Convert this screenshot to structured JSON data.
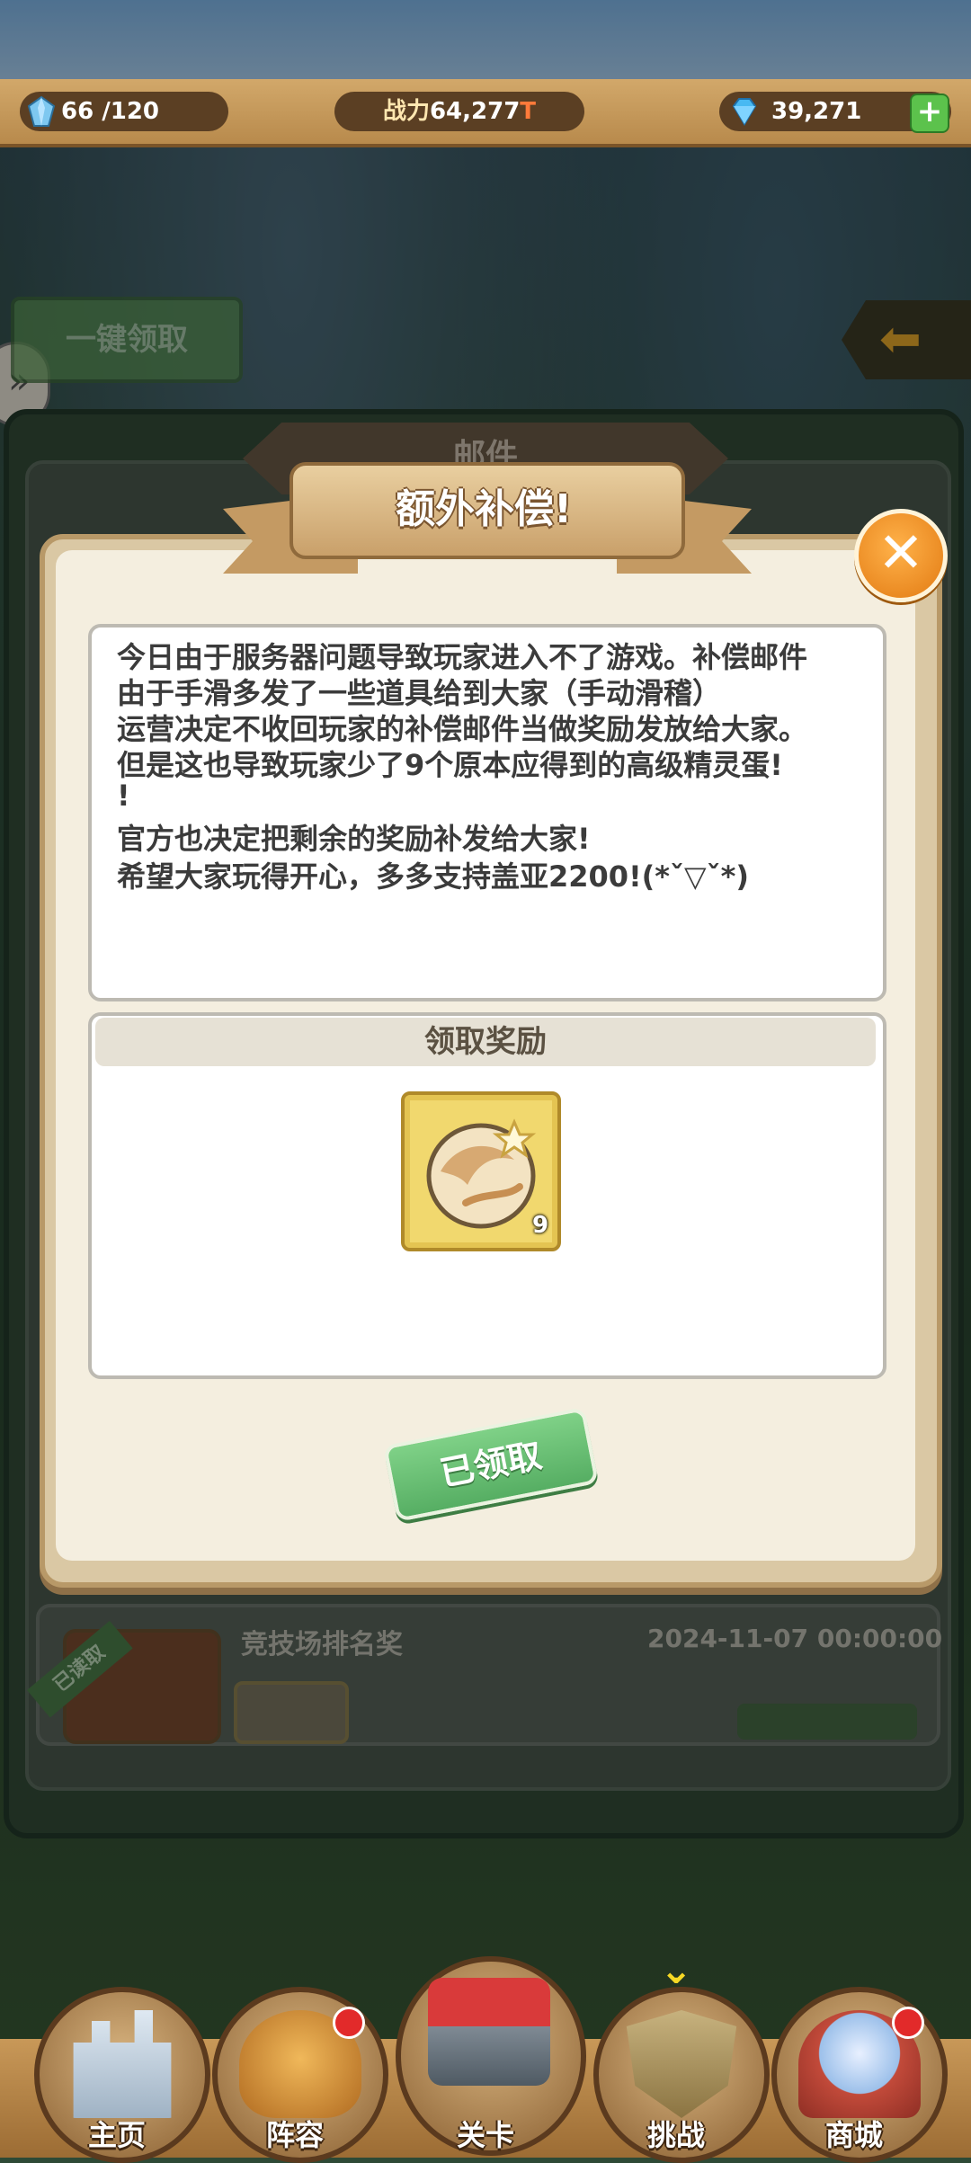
{
  "top_bar": {
    "stamina": "66 /120",
    "power_label": "战力",
    "power_value": "64,277",
    "power_unit": "T",
    "gems": "39,271",
    "add_icon": "plus-icon"
  },
  "mail_screen": {
    "claim_all_label": "一键领取",
    "back_icon": "arrow-left-icon",
    "title": "邮件",
    "items": [
      {
        "status": "已读取",
        "title": "竞技场排名奖",
        "date": "2024-11-07 00:00:00"
      }
    ]
  },
  "dialog": {
    "title": "额外补偿!",
    "close_icon": "close-icon",
    "message_lines": [
      "今日由于服务器问题导致玩家进入不了游戏。补偿邮件",
      "由于手滑多发了一些道具给到大家（手动滑稽）",
      "运营决定不收回玩家的补偿邮件当做奖励发放给大家。",
      "但是这也导致玩家少了9个原本应得到的高级精灵蛋!",
      "!",
      "官方也决定把剩余的奖励补发给大家!",
      "希望大家玩得开心，多多支持盖亚2200!(*ˇ▽ˇ*)"
    ],
    "reward_header": "领取奖励",
    "reward_item": {
      "icon": "spirit-egg-icon",
      "count": "9"
    },
    "claimed_label": "已领取"
  },
  "bottom_nav": [
    {
      "label": "主页",
      "icon": "castle-icon",
      "badge": false
    },
    {
      "label": "阵容",
      "icon": "knight-helmet-icon",
      "badge": true
    },
    {
      "label": "关卡",
      "icon": "pirate-fortress-icon",
      "badge": false
    },
    {
      "label": "挑战",
      "icon": "shield-swords-icon",
      "badge": false
    },
    {
      "label": "商城",
      "icon": "gacha-machine-icon",
      "badge": true
    }
  ],
  "colors": {
    "accent_gold": "#c9a06a",
    "claimed_green": "#56ae63",
    "close_orange": "#e27a12"
  }
}
